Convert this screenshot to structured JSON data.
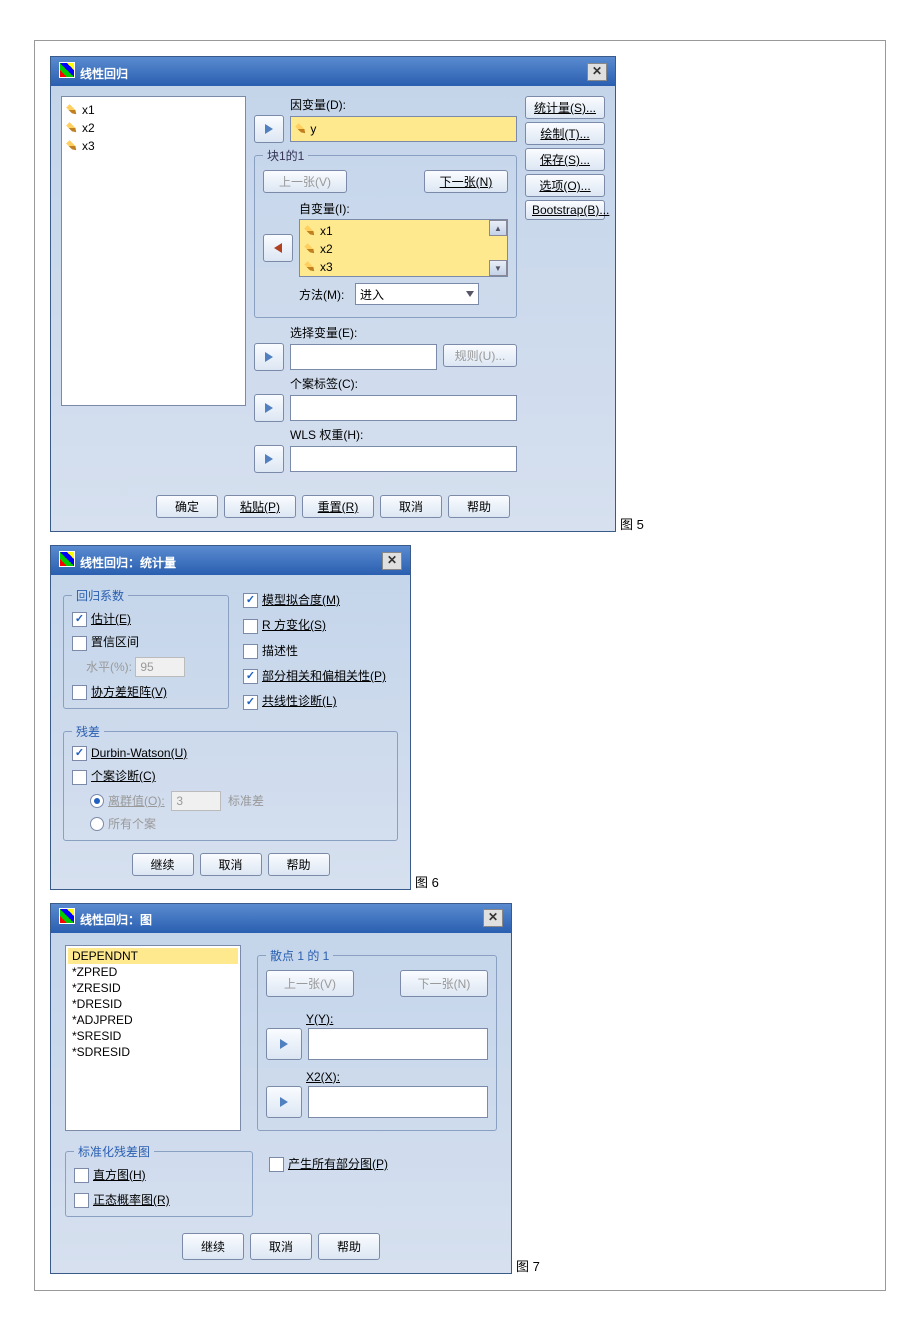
{
  "fig5": "图 5",
  "fig6": "图 6",
  "fig7": "图 7",
  "d1": {
    "title": "线性回归",
    "vars": [
      "x1",
      "x2",
      "x3"
    ],
    "dep_label": "因变量(D):",
    "dep_value": "y",
    "block_title": "块1的1",
    "prev": "上一张(V)",
    "next": "下一张(N)",
    "iv_label": "自变量(I):",
    "ivs": [
      "x1",
      "x2",
      "x3"
    ],
    "method_label": "方法(M):",
    "method_value": "进入",
    "selvar_label": "选择变量(E):",
    "rule_btn": "规则(U)...",
    "case_label": "个案标签(C):",
    "wls_label": "WLS 权重(H):",
    "ok": "确定",
    "paste": "粘贴(P)",
    "reset": "重置(R)",
    "cancel": "取消",
    "help": "帮助",
    "side": {
      "stat": "统计量(S)...",
      "plot": "绘制(T)...",
      "save": "保存(S)...",
      "opt": "选项(O)...",
      "boot": "Bootstrap(B)..."
    }
  },
  "d2": {
    "title": "线性回归：统计量",
    "coef_title": "回归系数",
    "est": "估计(E)",
    "ci": "置信区间",
    "lvl_lbl": "水平(%):",
    "lvl_val": "95",
    "cov": "协方差矩阵(V)",
    "fit": "模型拟合度(M)",
    "r2": "R 方变化(S)",
    "desc": "描述性",
    "part": "部分相关和偏相关性(P)",
    "coll": "共线性诊断(L)",
    "resid_title": "残差",
    "dw": "Durbin-Watson(U)",
    "cd": "个案诊断(C)",
    "out": "离群值(O):",
    "out_val": "3",
    "std": "标准差",
    "all": "所有个案",
    "cont": "继续",
    "cancel": "取消",
    "help": "帮助"
  },
  "d3": {
    "title": "线性回归：图",
    "list": [
      "DEPENDNT",
      "*ZPRED",
      "*ZRESID",
      "*DRESID",
      "*ADJPRED",
      "*SRESID",
      "*SDRESID"
    ],
    "scatter_title": "散点 1 的 1",
    "prev": "上一张(V)",
    "next": "下一张(N)",
    "y_lbl": "Y(Y):",
    "x_lbl": "X2(X):",
    "stdres_title": "标准化残差图",
    "hist": "直方图(H)",
    "npp": "正态概率图(R)",
    "allpart": "产生所有部分图(P)",
    "cont": "继续",
    "cancel": "取消",
    "help": "帮助"
  }
}
